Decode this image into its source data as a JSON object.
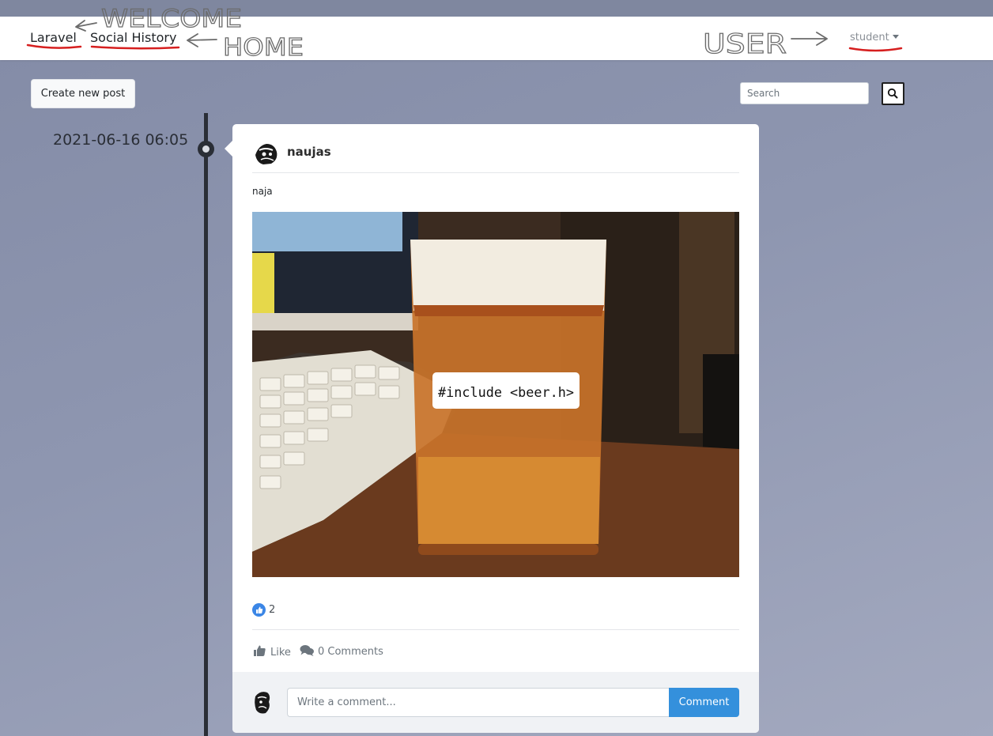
{
  "navbar": {
    "brand": "Laravel",
    "home_link": "Social History",
    "user_menu": "student"
  },
  "annotations": {
    "welcome": "WELCOME",
    "home": "HOME",
    "user": "USER"
  },
  "toolbar": {
    "create_post_label": "Create new post",
    "search_placeholder": "Search"
  },
  "timeline": {
    "entries": [
      {
        "date": "2021-06-16 06:05",
        "post": {
          "author": "naujas",
          "text": "naja",
          "image": {
            "glass_label": "#include <beer.h>"
          },
          "like_count": "2",
          "like_label": "Like",
          "comments_label": "0 Comments",
          "comment_placeholder": "Write a comment...",
          "comment_button": "Comment"
        }
      }
    ]
  },
  "colors": {
    "page_background": "#8a92ac",
    "navbar_background": "#ffffff",
    "timeline": "#2a2e36",
    "accent": "#3490dc",
    "annotation_underline": "#d61f1f"
  }
}
